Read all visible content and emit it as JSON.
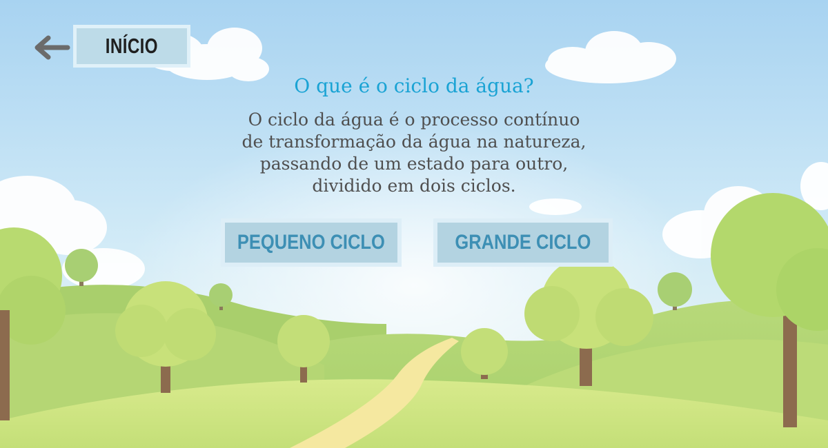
{
  "nav": {
    "back_label": "INÍCIO"
  },
  "content": {
    "title": "O que é o ciclo da água?",
    "description_lines": [
      "O ciclo da água é o processo contínuo",
      "de transformação da água na natureza,",
      "passando de um estado para outro,",
      "dividido em dois ciclos."
    ]
  },
  "choices": [
    {
      "label": "PEQUENO CICLO"
    },
    {
      "label": "GRANDE CICLO"
    }
  ],
  "icons": {
    "back": "arrow-left-icon"
  },
  "colors": {
    "title": "#1aa3d4",
    "body_text": "#4f4f4f",
    "button_fill": "#b3d3e1",
    "button_text": "#3d8fb4",
    "sky_top": "#a9d3f0",
    "grass": "#c6e07a"
  }
}
